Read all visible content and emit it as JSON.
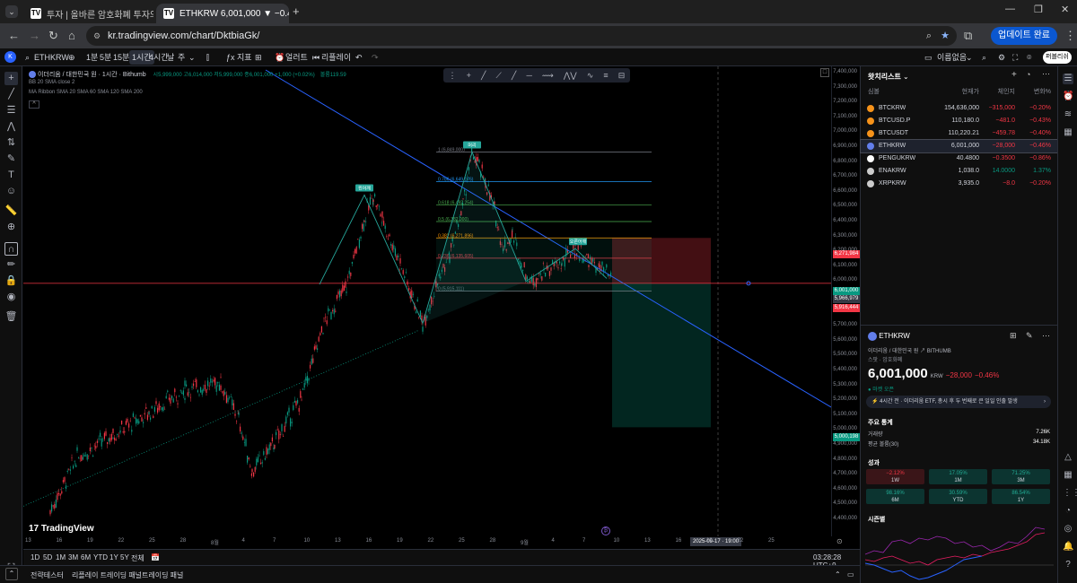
{
  "browser": {
    "tabs": [
      {
        "label": "투자 | 올바른 암호화폐 투자의 ...",
        "active": false
      },
      {
        "label": "ETHKRW 6,001,000 ▼ −0.46% ...",
        "active": true
      }
    ],
    "url": "kr.tradingview.com/chart/DktbiaGk/",
    "update_label": "업데이트 완료"
  },
  "toolbar": {
    "symbol": "ETHKRW",
    "intervals": [
      "1분",
      "5분",
      "15분",
      "1시간",
      "4시간",
      "날",
      "주"
    ],
    "selected_interval": "1시간",
    "indicators_label": "지표",
    "alert_label": "얼러트",
    "replay_label": "리플레이",
    "unnamed_label": "이름없음",
    "publish_label": "퍼블리쉬"
  },
  "chart": {
    "title": "이더리움 / 대한민국 원 · 1시간 · Bithumb",
    "ohlc": "시5,999,000 고6,014,000 저5,999,000 종6,001,000 +1,000 (+0.02%)",
    "volume": "볼륨119.59",
    "indicator1": "BB 20 SMA close 2",
    "indicator2": "MA Ribbon SMA 20 SMA 60 SMA 120 SMA 200",
    "watermark": "TradingView",
    "fib_levels": [
      {
        "label": "1 (6,849,000)",
        "price": 6849000
      },
      {
        "label": "0.786 (6,649,176)",
        "price": 6649176
      },
      {
        "label": "0.618 (6,492,254)",
        "price": 6492254
      },
      {
        "label": "0.5 (6,382,000)",
        "price": 6382000
      },
      {
        "label": "0.382 (6,271,896)",
        "price": 6271896
      },
      {
        "label": "0.236 (6,135,605)",
        "price": 6135605
      },
      {
        "label": "0 (5,915,111)",
        "price": 5915111
      }
    ],
    "pattern_labels": {
      "left": "왼어깨",
      "head": "머리",
      "right": "오른어깨"
    },
    "price_ticks": [
      "7,400,000",
      "7,300,000",
      "7,200,000",
      "7,100,000",
      "7,000,000",
      "6,900,000",
      "6,800,000",
      "6,700,000",
      "6,600,000",
      "6,500,000",
      "6,400,000",
      "6,300,000",
      "6,200,000",
      "6,100,000",
      "6,000,000",
      "5,900,000",
      "5,800,000",
      "5,700,000",
      "5,600,000",
      "5,500,000",
      "5,400,000",
      "5,300,000",
      "5,200,000",
      "5,100,000",
      "5,000,000",
      "4,900,000",
      "4,800,000",
      "4,700,000",
      "4,600,000",
      "4,500,000",
      "4,400,000"
    ],
    "price_labels": {
      "stop": "6,271,984",
      "last": "6,001,000",
      "cross": "5,966,979",
      "target_a": "5,916,444",
      "target_b": "5,000,198"
    },
    "time_ticks": [
      "13",
      "16",
      "19",
      "22",
      "25",
      "28",
      "8월",
      "4",
      "7",
      "10",
      "13",
      "16",
      "19",
      "22",
      "25",
      "28",
      "9월",
      "4",
      "7",
      "10",
      "13",
      "16",
      "19",
      "22",
      "25"
    ],
    "crosshair_time": "2025-09-17 · 19:00"
  },
  "rangebar": {
    "ranges": [
      "1D",
      "5D",
      "1M",
      "3M",
      "6M",
      "YTD",
      "1Y",
      "5Y",
      "전체"
    ],
    "clock": "03:28:28 UTC+9"
  },
  "bottom_tabs": [
    "전략테스터",
    "리플레이 트레이딩 패널",
    "트레이딩 패널"
  ],
  "watchlist": {
    "title": "왓치리스트",
    "headers": {
      "symbol": "심볼",
      "last": "현재가",
      "chg": "체인지",
      "chgp": "변화%"
    },
    "rows": [
      {
        "symbol": "BTCKRW",
        "last": "154,636,000",
        "chg": "−315,000",
        "chgp": "−0.20%",
        "color": "#f7931a",
        "dir": "neg"
      },
      {
        "symbol": "BTCUSD.P",
        "last": "110,180.0",
        "chg": "−481.0",
        "chgp": "−0.43%",
        "color": "#f7931a",
        "dir": "neg"
      },
      {
        "symbol": "BTCUSDT",
        "last": "110,220.21",
        "chg": "−459.78",
        "chgp": "−0.40%",
        "color": "#f7931a",
        "dir": "neg"
      },
      {
        "symbol": "ETHKRW",
        "last": "6,001,000",
        "chg": "−28,000",
        "chgp": "−0.46%",
        "color": "#627eea",
        "dir": "neg"
      },
      {
        "symbol": "PENGUKRW",
        "last": "40.4800",
        "chg": "−0.3500",
        "chgp": "−0.86%",
        "color": "#ffffff",
        "dir": "neg"
      },
      {
        "symbol": "ENAKRW",
        "last": "1,038.0",
        "chg": "14.0000",
        "chgp": "1.37%",
        "color": "#cccccc",
        "dir": "pos"
      },
      {
        "symbol": "XRPKRW",
        "last": "3,935.0",
        "chg": "−8.0",
        "chgp": "−0.20%",
        "color": "#cccccc",
        "dir": "neg"
      }
    ]
  },
  "details": {
    "symbol": "ETHKRW",
    "name": "이더리움 / 대한민국 원",
    "exchange": "BITHUMB",
    "type": "스팟 · 암호화폐",
    "price": "6,001,000",
    "currency": "KRW",
    "change": "−28,000",
    "change_pct": "−0.46%",
    "market_status": "● 마켓 오픈",
    "news": "4시간 전 · 이더리움 ETF, 총시 후 두 번째로 큰 일일 인출 발생",
    "key_stats_title": "주요 통계",
    "stats": [
      {
        "label": "거래량",
        "value": "7.26K"
      },
      {
        "label": "평균 볼륨(30)",
        "value": "34.18K"
      }
    ],
    "perf_title": "성과",
    "perf": [
      {
        "value": "−2.12%",
        "period": "1W",
        "dir": "neg"
      },
      {
        "value": "17.05%",
        "period": "1M",
        "dir": "pos"
      },
      {
        "value": "71.25%",
        "period": "3M",
        "dir": "pos"
      },
      {
        "value": "98.16%",
        "period": "6M",
        "dir": "pos"
      },
      {
        "value": "30.59%",
        "period": "YTD",
        "dir": "pos"
      },
      {
        "value": "86.54%",
        "period": "1Y",
        "dir": "pos"
      }
    ],
    "seasonal_title": "시즌별"
  }
}
